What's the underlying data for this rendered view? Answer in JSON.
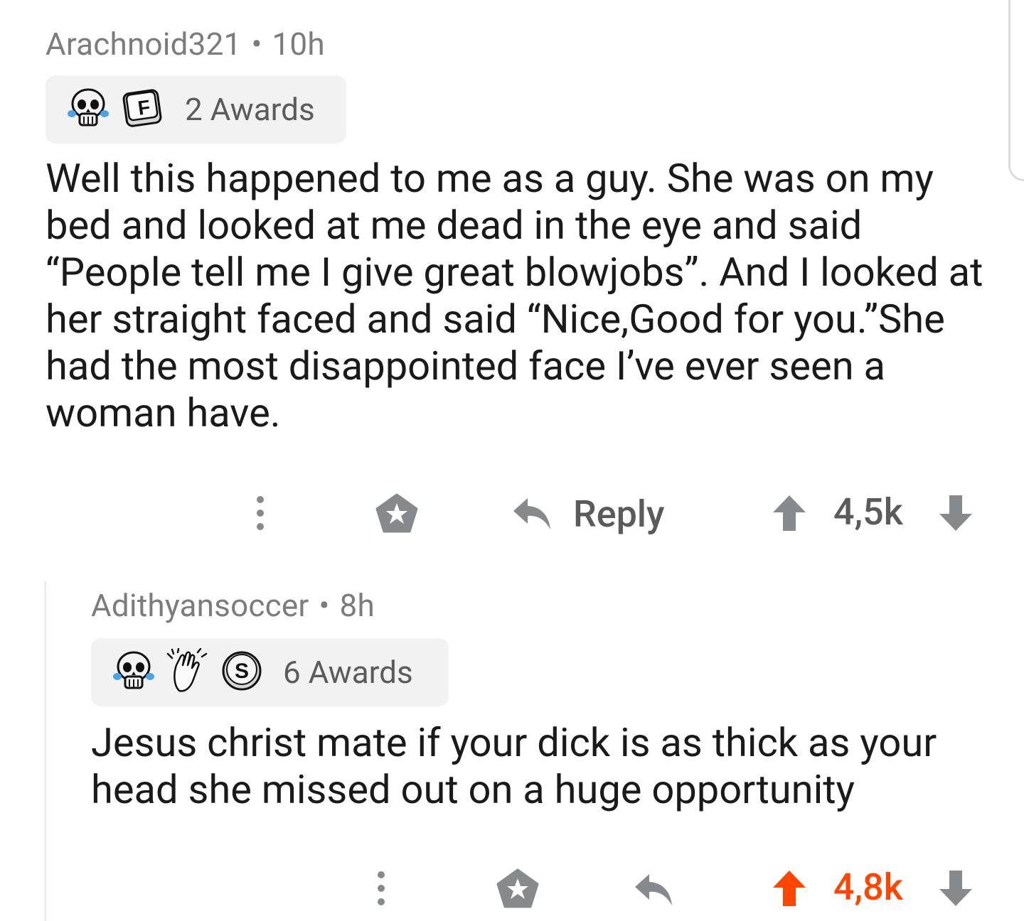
{
  "comments": [
    {
      "author": "Arachnoid321",
      "separator": "•",
      "time": "10h",
      "awards": {
        "icons": [
          "crying-skull-icon",
          "press-f-icon"
        ],
        "label": "2 Awards"
      },
      "body": "Well this happened to me as a guy. She was on my bed and looked at me dead in the eye and said “People tell me I give great blowjobs”. And I looked at her straight faced and said “Nice,Good for you.”She had the most disappointed face I’ve ever seen a woman have.",
      "actions": {
        "reply_label": "Reply",
        "score": "4,5k",
        "upvoted": false
      }
    },
    {
      "author": "Adithyansoccer",
      "separator": "•",
      "time": "8h",
      "awards": {
        "icons": [
          "crying-skull-icon",
          "clapping-hands-icon",
          "silver-award-icon"
        ],
        "label": "6 Awards"
      },
      "body": "Jesus christ mate if your dick is as thick as your head she missed out on a huge opportunity",
      "actions": {
        "reply_label": "",
        "score": "4,8k",
        "upvoted": true
      }
    }
  ],
  "colors": {
    "meta_text": "#7c7c7c",
    "body_text": "#1a1a1b",
    "icon_gray": "#878a8c",
    "upvote_orange": "#ff4500",
    "award_bg": "#f2f2f2"
  }
}
